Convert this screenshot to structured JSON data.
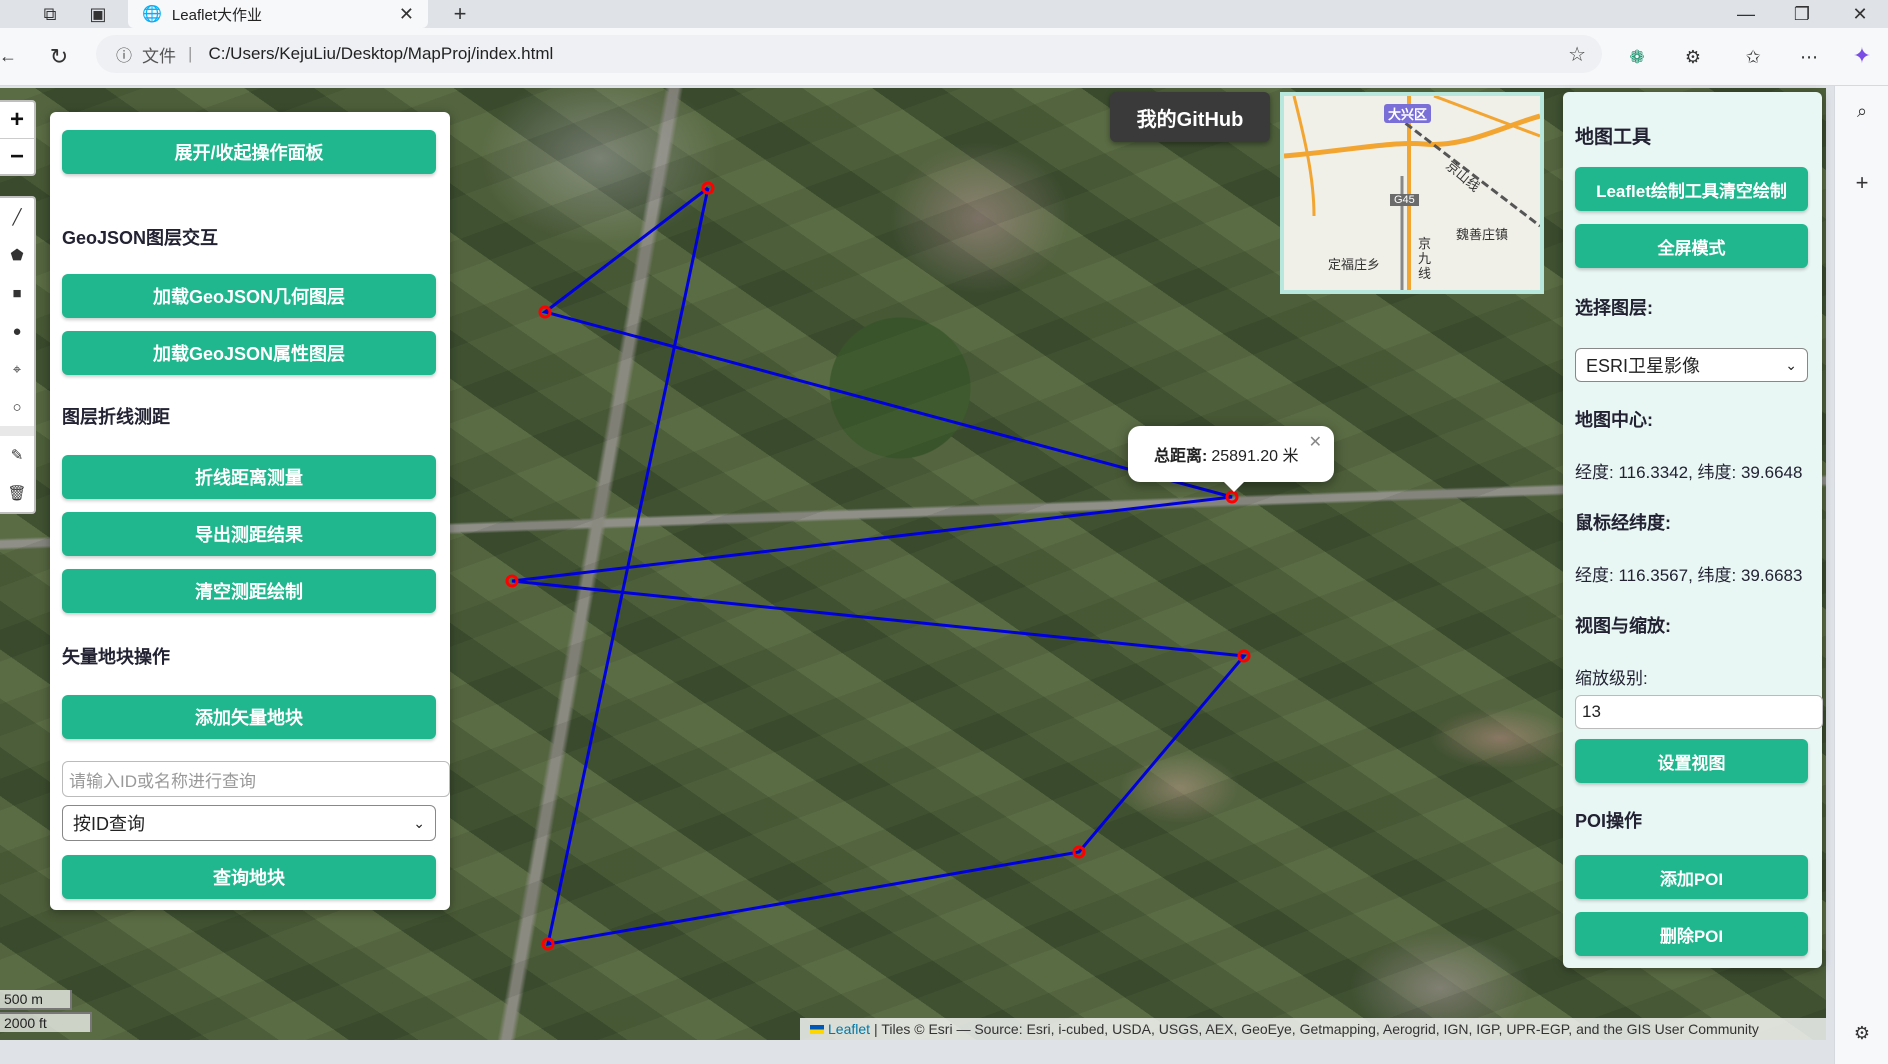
{
  "browser": {
    "tab_title": "Leaflet大作业",
    "url_label": "文件",
    "url": "C:/Users/KejuLiu/Desktop/MapProj/index.html"
  },
  "left_panel": {
    "toggle_btn": "展开/收起操作面板",
    "section_geojson": "GeoJSON图层交互",
    "load_geom_btn": "加载GeoJSON几何图层",
    "load_attr_btn": "加载GeoJSON属性图层",
    "section_measure": "图层折线测距",
    "measure_btn": "折线距离测量",
    "export_btn": "导出测距结果",
    "clear_measure_btn": "清空测距绘制",
    "section_vector": "矢量地块操作",
    "add_block_btn": "添加矢量地块",
    "query_placeholder": "请输入ID或名称进行查询",
    "query_mode": "按ID查询",
    "query_btn": "查询地块"
  },
  "github_btn": "我的GitHub",
  "minimap": {
    "labels": [
      "大兴区",
      "G45",
      "京山线",
      "魏善庄镇",
      "定福庄乡",
      "京九线"
    ]
  },
  "popup": {
    "label": "总距离:",
    "value": "25891.20 米"
  },
  "right_panel": {
    "title": "地图工具",
    "clear_draw_btn": "Leaflet绘制工具清空绘制",
    "fullscreen_btn": "全屏模式",
    "layer_label": "选择图层:",
    "layer_value": "ESRI卫星影像",
    "center_label": "地图中心:",
    "center_value": "经度: 116.3342, 纬度: 39.6648",
    "mouse_label": "鼠标经纬度:",
    "mouse_value": "经度: 116.3567, 纬度: 39.6683",
    "view_label": "视图与缩放:",
    "zoom_label": "缩放级别:",
    "zoom_value": "13",
    "set_view_btn": "设置视图",
    "poi_label": "POI操作",
    "add_poi_btn": "添加POI",
    "del_poi_btn": "删除POI"
  },
  "scale": {
    "metric": "500 m",
    "imperial": "2000 ft"
  },
  "attribution": {
    "leaflet": "Leaflet",
    "text": "| Tiles © Esri — Source: Esri, i-cubed, USDA, USGS, AEX, GeoEye, Getmapping, Aerogrid, IGN, IGP, UPR-EGP, and the GIS User Community"
  },
  "colors": {
    "accent": "#21b78e",
    "polyline": "#0000dd",
    "vertex": "#ff0000"
  }
}
